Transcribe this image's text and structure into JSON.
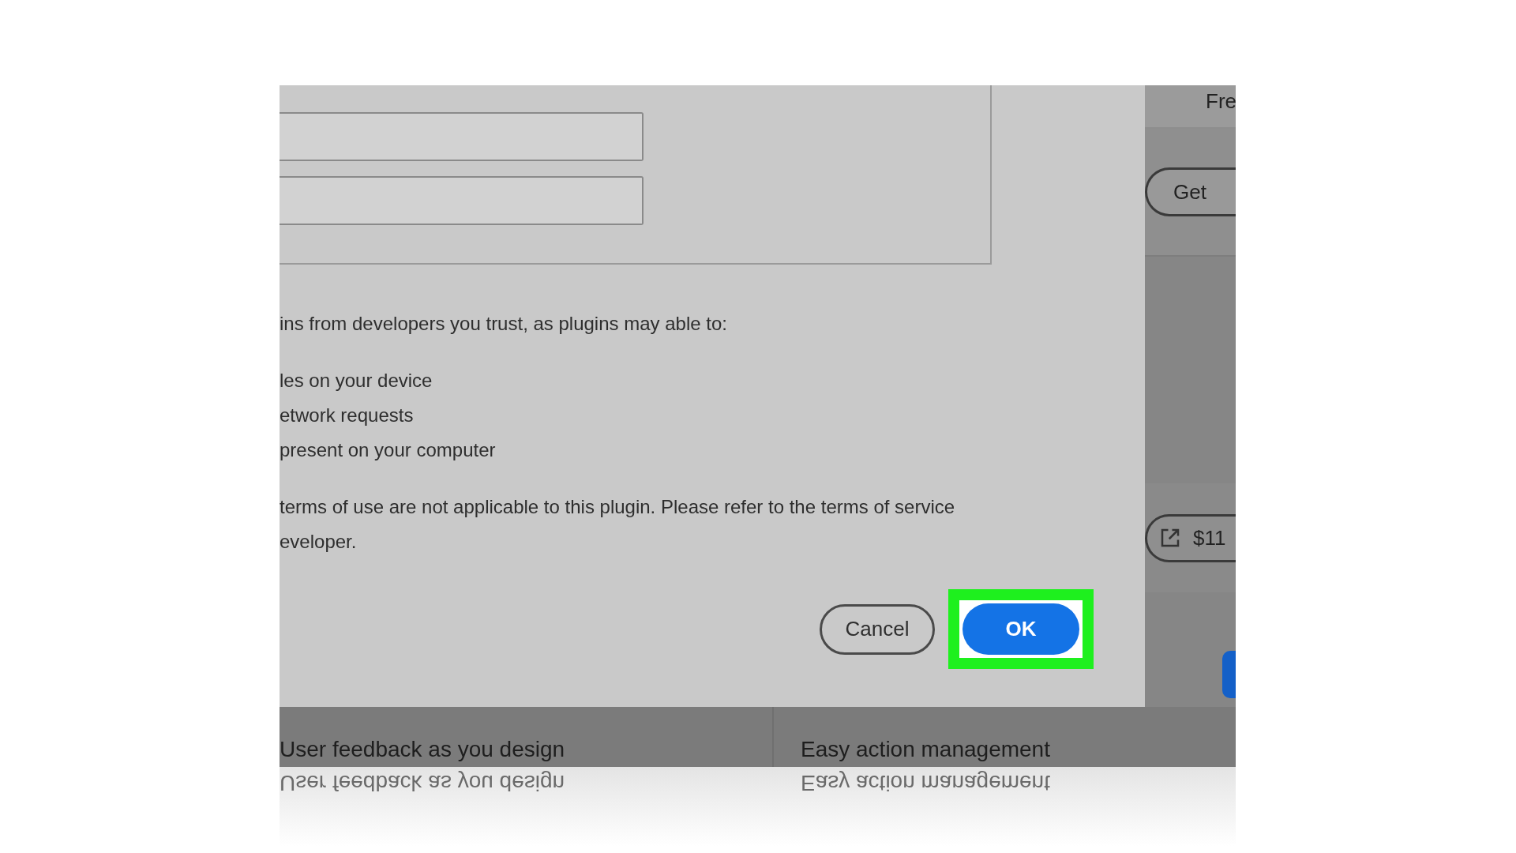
{
  "dialog": {
    "intro": "ins from developers you trust, as plugins may able to:",
    "capabilities": [
      "les on your device",
      "etwork requests",
      "present on your computer"
    ],
    "notice": [
      "terms of use are not applicable to this plugin. Please refer to the terms of service",
      "eveloper."
    ],
    "buttons": [
      {
        "label": "Cancel",
        "kind": "secondary",
        "highlighted": false
      },
      {
        "label": "OK",
        "kind": "primary",
        "highlighted": true
      }
    ]
  },
  "side_panel": {
    "heading": "Fre",
    "buttons": [
      {
        "label": "Get",
        "kind": "get"
      },
      {
        "label": "$11",
        "kind": "external"
      },
      {
        "kind": "primary"
      }
    ]
  },
  "features": [
    {
      "title": "User feedback as you design"
    },
    {
      "title": "Easy action management"
    }
  ],
  "reflection": [
    "User feedback as you design",
    "Easy action management"
  ]
}
